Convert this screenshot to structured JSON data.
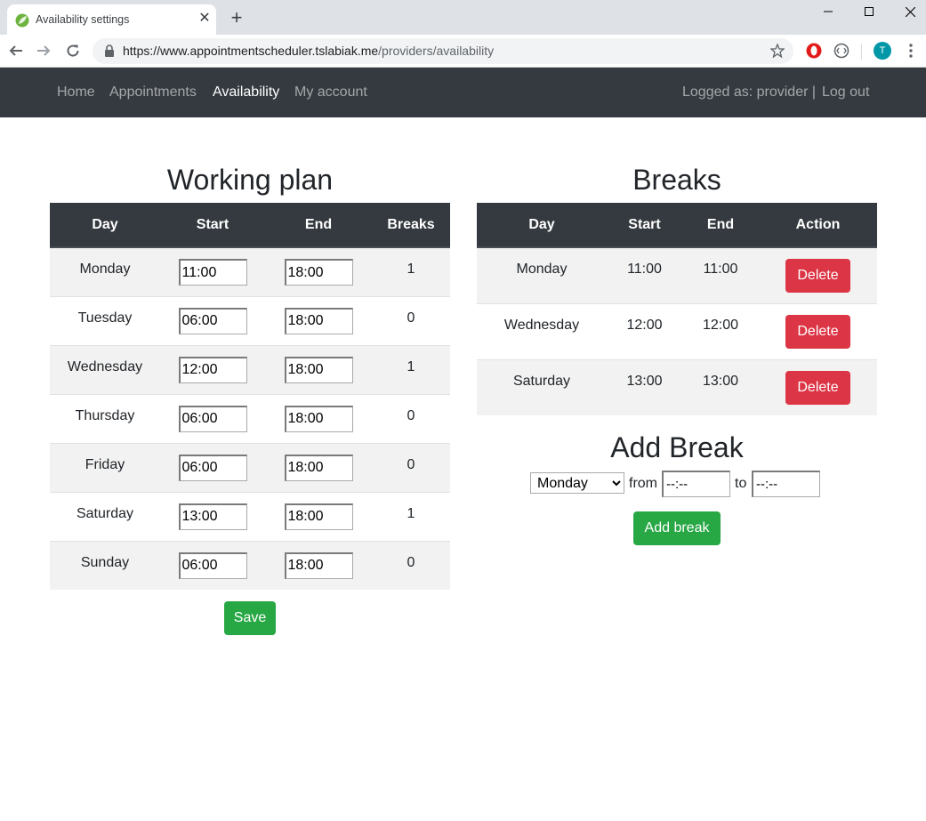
{
  "browser": {
    "tab_title": "Availability settings",
    "url_host": "https://www.appointmentscheduler.tslabiak.me",
    "url_path": "/providers/availability",
    "profile_initial": "T"
  },
  "navbar": {
    "links": [
      "Home",
      "Appointments",
      "Availability",
      "My account"
    ],
    "active": "Availability",
    "logged_as": "Logged as: provider |",
    "logout": "Log out"
  },
  "working_plan": {
    "title": "Working plan",
    "headers": [
      "Day",
      "Start",
      "End",
      "Breaks"
    ],
    "rows": [
      {
        "day": "Monday",
        "start": "11:00",
        "end": "18:00",
        "breaks": "1"
      },
      {
        "day": "Tuesday",
        "start": "06:00",
        "end": "18:00",
        "breaks": "0"
      },
      {
        "day": "Wednesday",
        "start": "12:00",
        "end": "18:00",
        "breaks": "1"
      },
      {
        "day": "Thursday",
        "start": "06:00",
        "end": "18:00",
        "breaks": "0"
      },
      {
        "day": "Friday",
        "start": "06:00",
        "end": "18:00",
        "breaks": "0"
      },
      {
        "day": "Saturday",
        "start": "13:00",
        "end": "18:00",
        "breaks": "1"
      },
      {
        "day": "Sunday",
        "start": "06:00",
        "end": "18:00",
        "breaks": "0"
      }
    ],
    "save_label": "Save"
  },
  "breaks": {
    "title": "Breaks",
    "headers": [
      "Day",
      "Start",
      "End",
      "Action"
    ],
    "rows": [
      {
        "day": "Monday",
        "start": "11:00",
        "end": "11:00",
        "action": "Delete"
      },
      {
        "day": "Wednesday",
        "start": "12:00",
        "end": "12:00",
        "action": "Delete"
      },
      {
        "day": "Saturday",
        "start": "13:00",
        "end": "13:00",
        "action": "Delete"
      }
    ]
  },
  "add_break": {
    "title": "Add Break",
    "day_selected": "Monday",
    "from_label": "from",
    "to_label": "to",
    "from_value": "--:--",
    "to_value": "--:--",
    "button_label": "Add break"
  },
  "colors": {
    "navbar_bg": "#343a40",
    "danger": "#dc3545",
    "success": "#28a745",
    "stripe": "#f2f2f2"
  }
}
